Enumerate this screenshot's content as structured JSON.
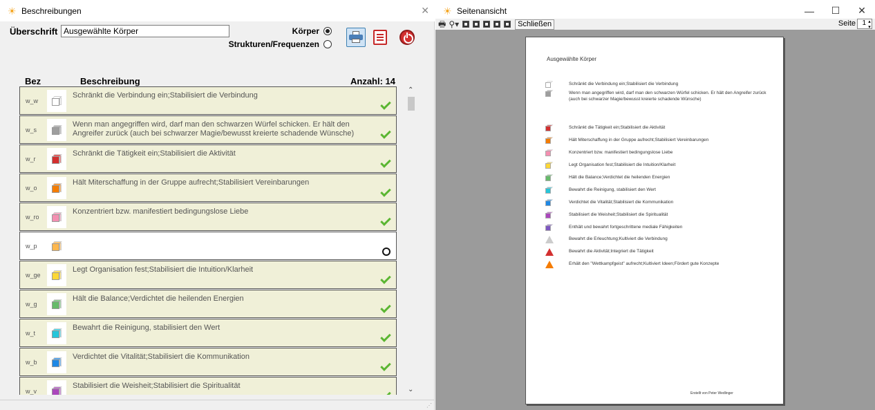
{
  "left_window": {
    "title": "Beschreibungen",
    "heading_label": "Überschrift",
    "heading_value": "Ausgewählte Körper",
    "radio_koerper_label": "Körper",
    "radio_strukturen_label": "Strukturen/Frequenzen",
    "radio_selected": "Körper",
    "columns": {
      "bez": "Bez",
      "beschreibung": "Beschreibung",
      "anzahl": "Anzahl: 14"
    },
    "rows": [
      {
        "bez": "w_w",
        "desc": "Schränkt die Verbindung ein;Stabilisiert die Verbindung",
        "color": "#ffffff",
        "status": "check"
      },
      {
        "bez": "w_s",
        "desc": "Wenn man angegriffen wird, darf man den schwarzen Würfel schicken. Er hält den Angreifer zurück (auch bei schwarzer Magie/bewusst kreierte schadende Wünsche)",
        "color": "#9e9e9e",
        "status": "check"
      },
      {
        "bez": "w_r",
        "desc": "Schränkt die Tätigkeit ein;Stabilisiert die Aktivität",
        "color": "#d32f2f",
        "status": "check"
      },
      {
        "bez": "w_o",
        "desc": "Hält Miterschaffung in der Gruppe aufrecht;Stabilisiert Vereinbarungen",
        "color": "#f57c00",
        "status": "check"
      },
      {
        "bez": "w_ro",
        "desc": "Konzentriert bzw. manifestiert bedingungslose Liebe",
        "color": "#f48fb1",
        "status": "check"
      },
      {
        "bez": "w_p",
        "desc": "",
        "color": "#ffb74d",
        "status": "empty"
      },
      {
        "bez": "w_ge",
        "desc": "Legt Organisation fest;Stabilisiert die Intuition/Klarheit",
        "color": "#fdd835",
        "status": "check"
      },
      {
        "bez": "w_g",
        "desc": "Hält die Balance;Verdichtet die heilenden Energien",
        "color": "#66bb6a",
        "status": "check"
      },
      {
        "bez": "w_t",
        "desc": "Bewahrt die Reinigung, stabilisiert den Wert",
        "color": "#26c6da",
        "status": "check"
      },
      {
        "bez": "w_b",
        "desc": "Verdichtet die Vitalität;Stabilisiert die Kommunikation",
        "color": "#1e88e5",
        "status": "check"
      },
      {
        "bez": "w_v",
        "desc": "Stabilisiert die Weisheit;Stabilisiert die Spiritualität",
        "color": "#ab47bc",
        "status": "check"
      }
    ]
  },
  "right_window": {
    "title": "Seitenansicht",
    "close_button": "Schließen",
    "page_label": "Seite",
    "page_value": "1",
    "document": {
      "title": "Ausgewählte Körper",
      "footer": "Erstellt von Peter Wedlinger",
      "items": [
        {
          "desc": "Schränkt die Verbindung ein;Stabilisiert die Verbindung",
          "color": "#ffffff",
          "shape": "cube"
        },
        {
          "desc": "Wenn man angegriffen wird, darf man den schwarzen Würfel schicken. Er hält den Angreifer zurück (auch bei schwarzer Magie/bewusst kreierte schadende Wünsche)",
          "color": "#9e9e9e",
          "shape": "cube"
        },
        {
          "desc": "Schränkt die Tätigkeit ein;Stabilisiert die Aktivität",
          "color": "#d32f2f",
          "shape": "cube"
        },
        {
          "desc": "Hält Miterschaffung in der Gruppe aufrecht;Stabilisiert Vereinbarungen",
          "color": "#f57c00",
          "shape": "cube"
        },
        {
          "desc": "Konzentriert bzw. manifestiert bedingungslose Liebe",
          "color": "#f48fb1",
          "shape": "cube"
        },
        {
          "desc": "Legt Organisation fest;Stabilisiert die Intuition/Klarheit",
          "color": "#fdd835",
          "shape": "cube"
        },
        {
          "desc": "Hält die Balance;Verdichtet die heilenden Energien",
          "color": "#66bb6a",
          "shape": "cube"
        },
        {
          "desc": "Bewahrt die Reinigung, stabilisiert den Wert",
          "color": "#26c6da",
          "shape": "cube"
        },
        {
          "desc": "Verdichtet die Vitalität;Stabilisiert die Kommunikation",
          "color": "#1e88e5",
          "shape": "cube"
        },
        {
          "desc": "Stabilisiert die Weisheit;Stabilisiert die Spiritualität",
          "color": "#ab47bc",
          "shape": "cube"
        },
        {
          "desc": "Enthält und bewahrt fortgeschrittene mediale Fähigkeiten",
          "color": "#7e57c2",
          "shape": "cube"
        },
        {
          "desc": "Bewahrt die Erleuchtung;Kultiviert die Verbindung",
          "color": "#ffffff",
          "shape": "triangle"
        },
        {
          "desc": "Bewahrt die Aktivität;Integriert die Tätigkeit",
          "color": "#d32f2f",
          "shape": "triangle"
        },
        {
          "desc": "Erhält den \"Wettkampfgeist\" aufrecht;Kultiviert Ideen;Fördert gute Konzepte",
          "color": "#f57c00",
          "shape": "triangle"
        }
      ]
    }
  }
}
